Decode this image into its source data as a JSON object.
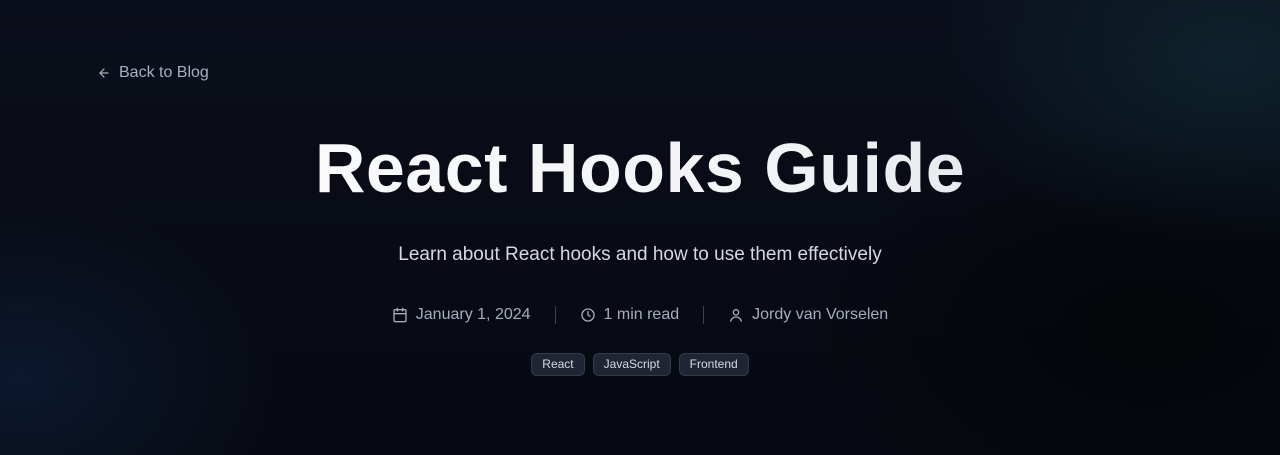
{
  "nav": {
    "back_label": "Back to Blog"
  },
  "post": {
    "title": "React Hooks Guide",
    "subtitle": "Learn about React hooks and how to use them effectively",
    "date": "January 1, 2024",
    "read_time": "1 min read",
    "author": "Jordy van Vorselen",
    "tags": [
      "React",
      "JavaScript",
      "Frontend"
    ]
  },
  "icons": {
    "back": "arrow-left-icon",
    "date": "calendar-icon",
    "read_time": "clock-icon",
    "author": "user-icon"
  },
  "colors": {
    "background": "#080b14",
    "muted_text": "#a4acbd",
    "tag_bg": "#1f2533"
  }
}
